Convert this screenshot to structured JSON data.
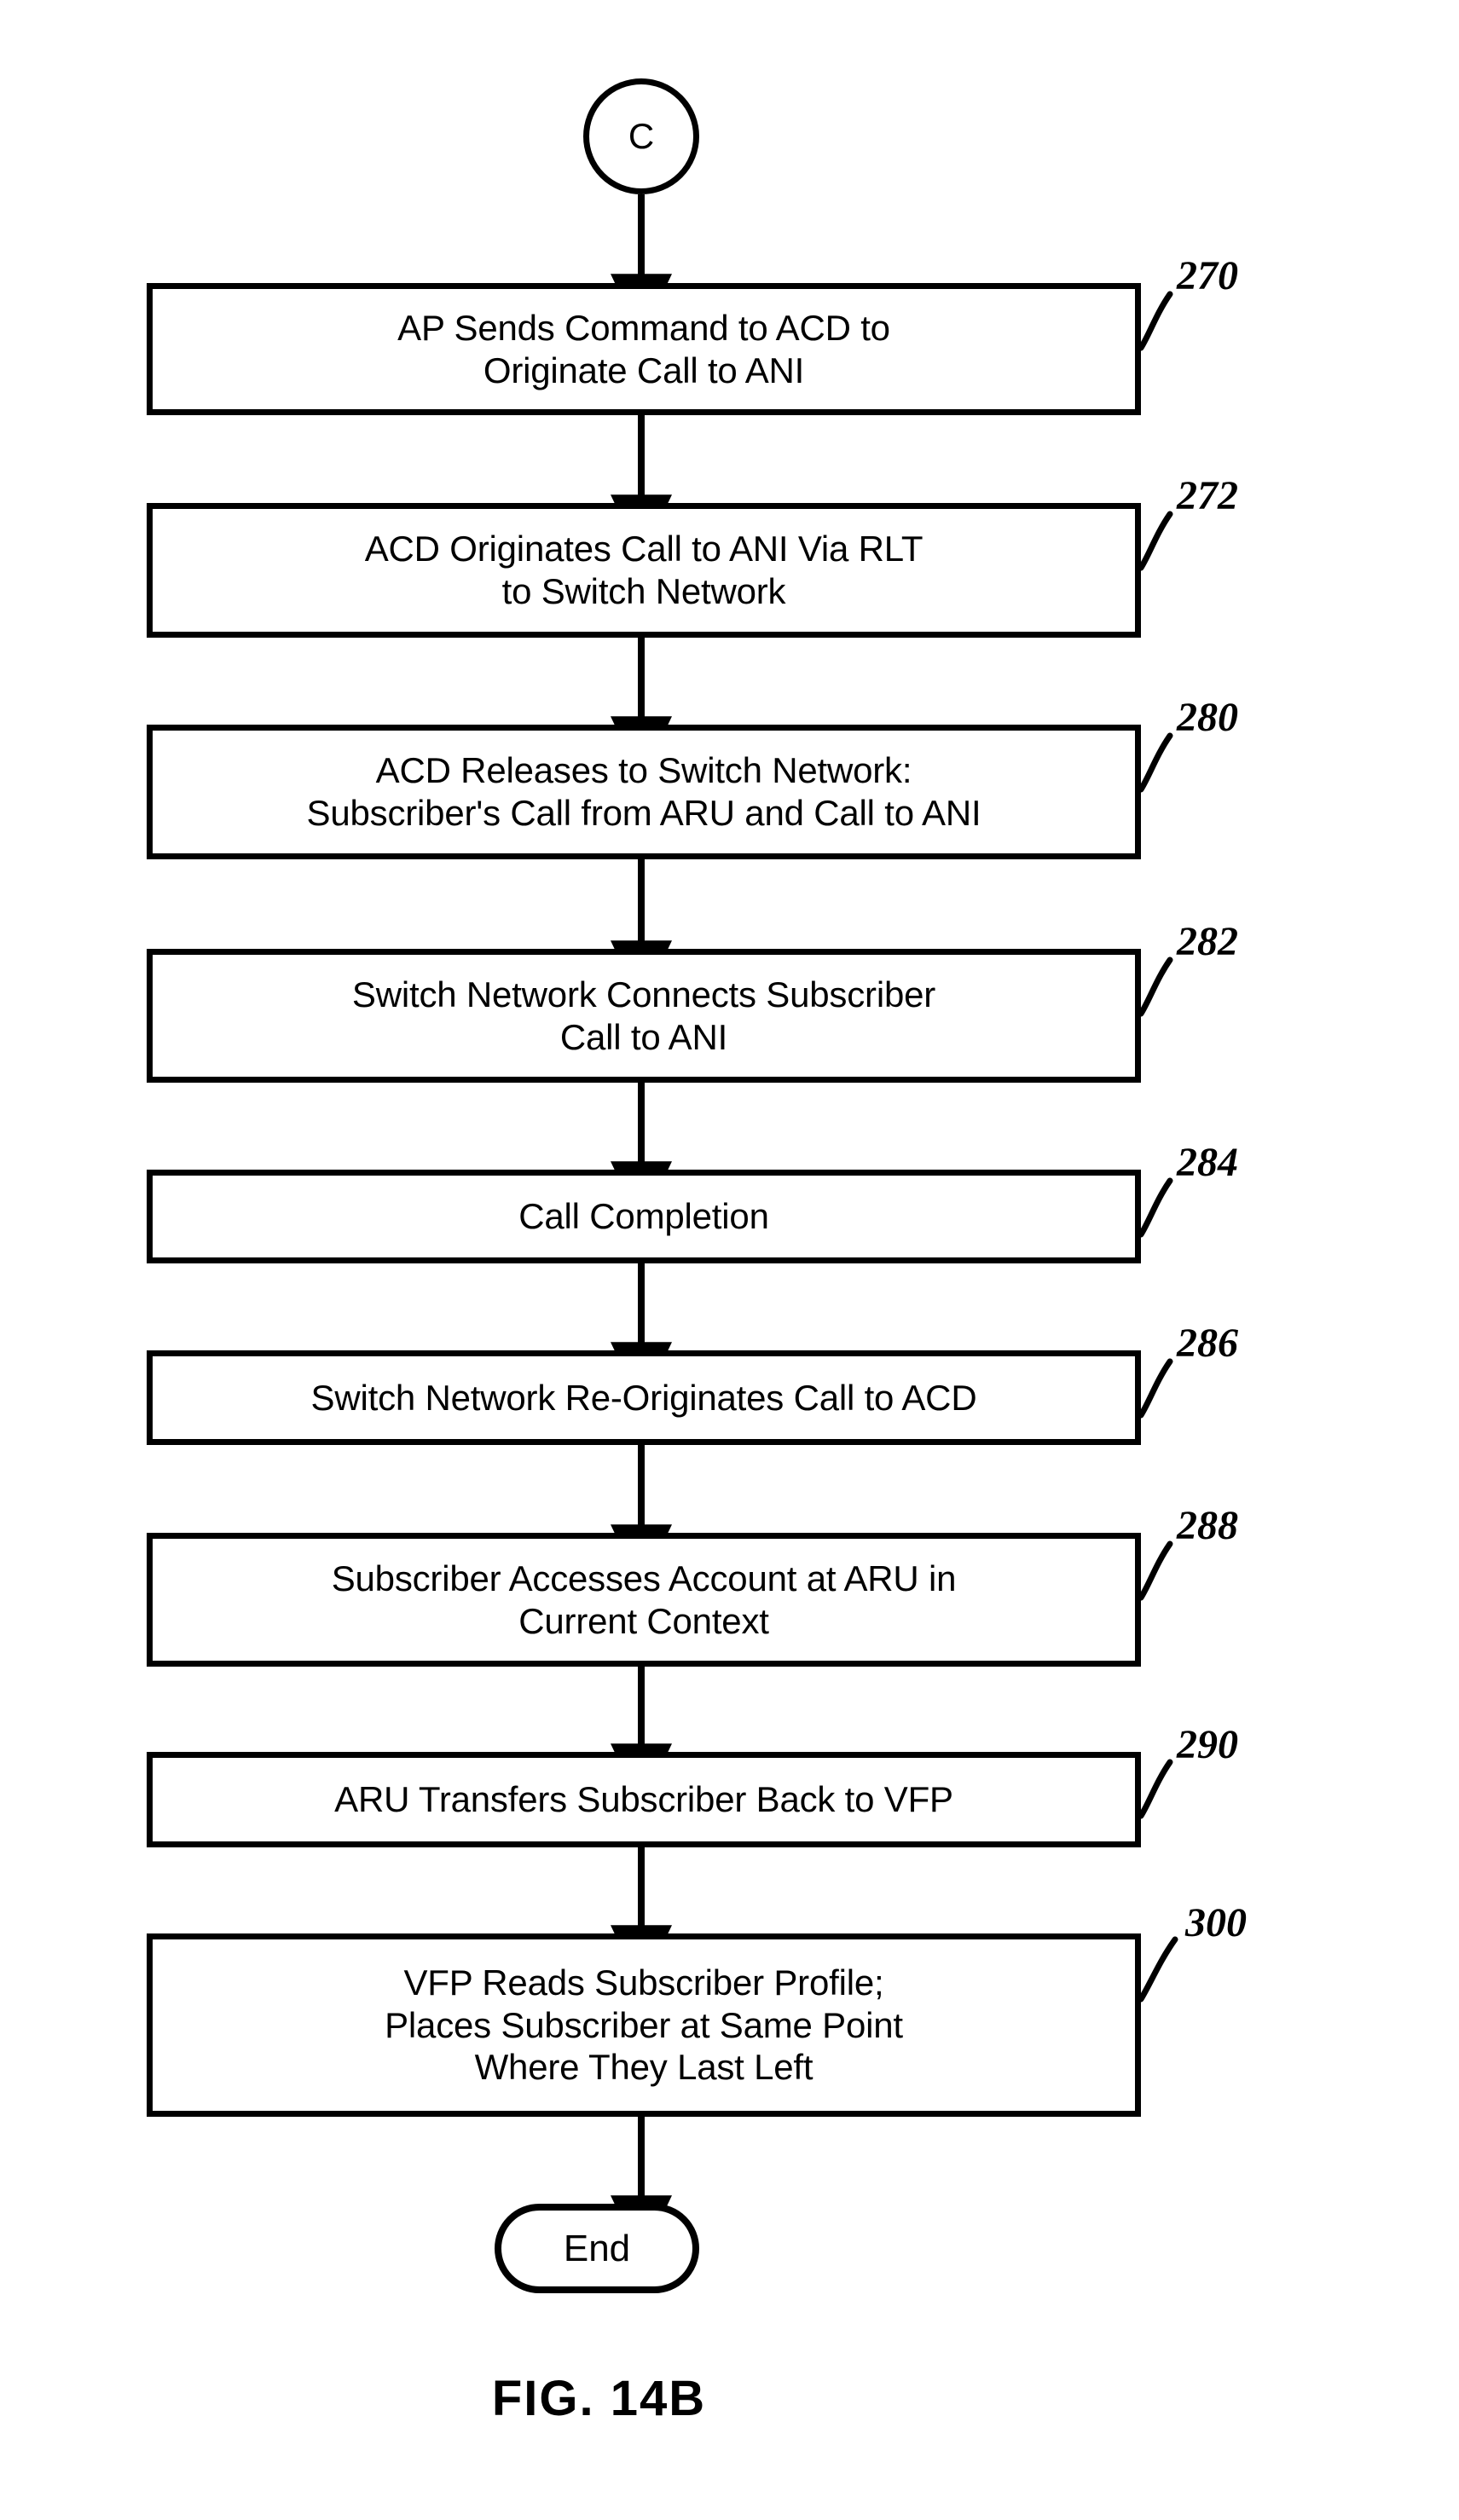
{
  "figure": {
    "caption": "FIG. 14B",
    "entry_connector": {
      "label": "C",
      "shape": "circle"
    },
    "exit_terminator": {
      "label": "End",
      "shape": "rounded-rectangle"
    },
    "steps": [
      {
        "ref": "270",
        "text": "AP Sends Command to ACD to\nOriginate Call to ANI",
        "lines": [
          "AP Sends Command to ACD to",
          "Originate Call to ANI"
        ]
      },
      {
        "ref": "272",
        "text": "ACD Originates Call to ANI Via RLT\nto Switch Network",
        "lines": [
          "ACD Originates Call to ANI Via RLT",
          "to Switch Network"
        ]
      },
      {
        "ref": "280",
        "text": "ACD Releases to Switch Network:\nSubscriber's Call from ARU and Call to ANI",
        "lines": [
          "ACD Releases to Switch Network:",
          "Subscriber's Call from ARU and Call to ANI"
        ]
      },
      {
        "ref": "282",
        "text": "Switch Network Connects Subscriber\nCall to ANI",
        "lines": [
          "Switch Network Connects Subscriber",
          "Call to ANI"
        ]
      },
      {
        "ref": "284",
        "text": "Call Completion",
        "lines": [
          "Call Completion"
        ]
      },
      {
        "ref": "286",
        "text": "Switch Network Re-Originates Call to ACD",
        "lines": [
          "Switch Network Re-Originates Call to ACD"
        ]
      },
      {
        "ref": "288",
        "text": "Subscriber Accesses Account at ARU in\nCurrent Context",
        "lines": [
          "Subscriber Accesses Account at ARU in",
          "Current Context"
        ]
      },
      {
        "ref": "290",
        "text": "ARU Transfers Subscriber Back to VFP",
        "lines": [
          "ARU Transfers Subscriber Back to VFP"
        ]
      },
      {
        "ref": "300",
        "text": "VFP Reads Subscriber Profile;\nPlaces Subscriber at Same Point\nWhere They Last Left",
        "lines": [
          "VFP Reads Subscriber Profile;",
          "Places Subscriber at Same Point",
          "Where They Last Left"
        ]
      }
    ],
    "colors": {
      "ink": "#000000",
      "paper": "#ffffff"
    }
  }
}
